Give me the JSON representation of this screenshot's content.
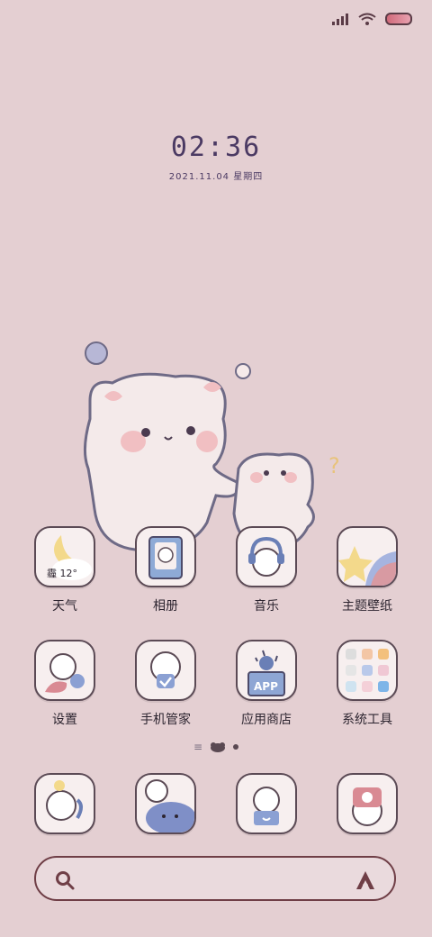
{
  "status": {
    "signal_icon": "signal-icon",
    "wifi_icon": "wifi-icon",
    "battery_icon": "battery-icon"
  },
  "clock": {
    "time": "02:36",
    "date": "2021.11.04 星期四"
  },
  "apps_row1": [
    {
      "name": "天气",
      "weather": "霾 12°"
    },
    {
      "name": "相册"
    },
    {
      "name": "音乐"
    },
    {
      "name": "主题壁纸"
    }
  ],
  "apps_row2": [
    {
      "name": "设置"
    },
    {
      "name": "手机管家"
    },
    {
      "name": "应用商店",
      "badge": "APP"
    },
    {
      "name": "系统工具"
    }
  ],
  "dock": [
    {
      "icon": "phone-icon"
    },
    {
      "icon": "messages-icon"
    },
    {
      "icon": "browser-icon"
    },
    {
      "icon": "camera-icon"
    }
  ],
  "search": {
    "search_icon": "search-icon",
    "assistant_icon": "assistant-icon"
  },
  "colors": {
    "background": "#e4cfd2",
    "text": "#2d2530",
    "accent": "#4b3a63"
  }
}
